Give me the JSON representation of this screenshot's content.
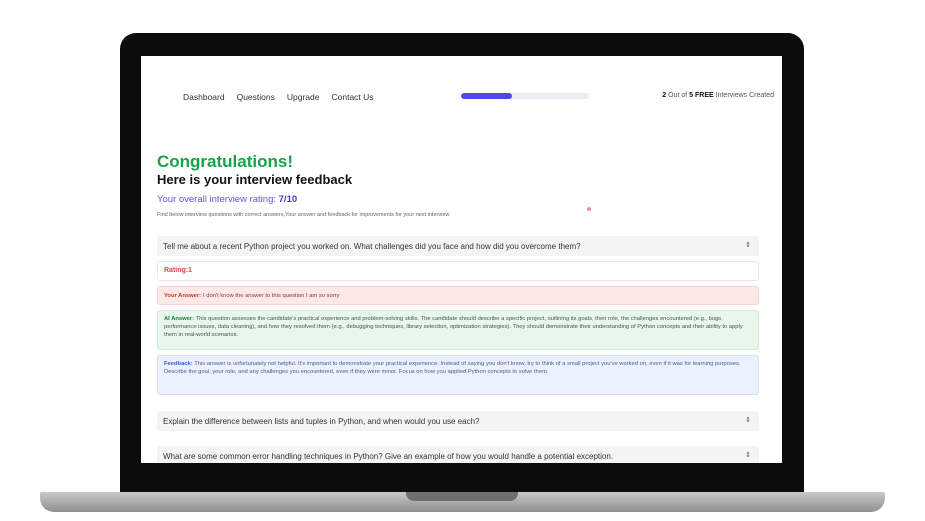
{
  "nav": {
    "items": [
      "Dashboard",
      "Questions",
      "Upgrade",
      "Contact Us"
    ]
  },
  "progress": {
    "fraction": 0.4
  },
  "counter": {
    "count": "2",
    "middle": "Out of",
    "free": "5 FREE",
    "suffix": "Interviews Created"
  },
  "feedback": {
    "congrats": "Congratulations!",
    "heading": "Here is your interview feedback",
    "rating_label": "Your overall interview rating:",
    "rating_value": "7/10",
    "subtitle": "Find below interview questions with correct answers,Your answer and feedback for improvements for your next interview"
  },
  "questions": [
    {
      "text": "Tell me about a recent Python project you worked on. What challenges did you face and how did you overcome them?"
    },
    {
      "text": "Explain the difference between lists and tuples in Python, and when would you use each?"
    },
    {
      "text": "What are some common error handling techniques in Python? Give an example of how you would handle a potential exception."
    }
  ],
  "details": {
    "rating_label": "Rating:",
    "rating_value": "1",
    "your_answer_label": "Your Answer:",
    "your_answer": "I don't know the answer to this question I am so sorry",
    "ai_answer_label": "AI Answer:",
    "ai_answer": "This question assesses the candidate's practical experience and problem-solving skills. The candidate should describe a specific project, outlining its goals, their role, the challenges encountered (e.g., bugs, performance issues, data cleaning), and how they resolved them (e.g., debugging techniques, library selection, optimization strategies). They should demonstrate their understanding of Python concepts and their ability to apply them in real-world scenarios.",
    "feedback_label": "Feedback:",
    "feedback": "This answer is unfortunately not helpful. It's important to demonstrate your practical experience. Instead of saying you don't know, try to think of a small project you've worked on, even if it was for learning purposes. Describe the goal, your role, and any challenges you encountered, even if they were minor. Focus on how you applied Python concepts to solve them."
  },
  "icons": {
    "expand": "chevron-up-down-icon"
  },
  "colors": {
    "accent": "#4f46e5",
    "success": "#16a34a",
    "error": "#e04444"
  }
}
